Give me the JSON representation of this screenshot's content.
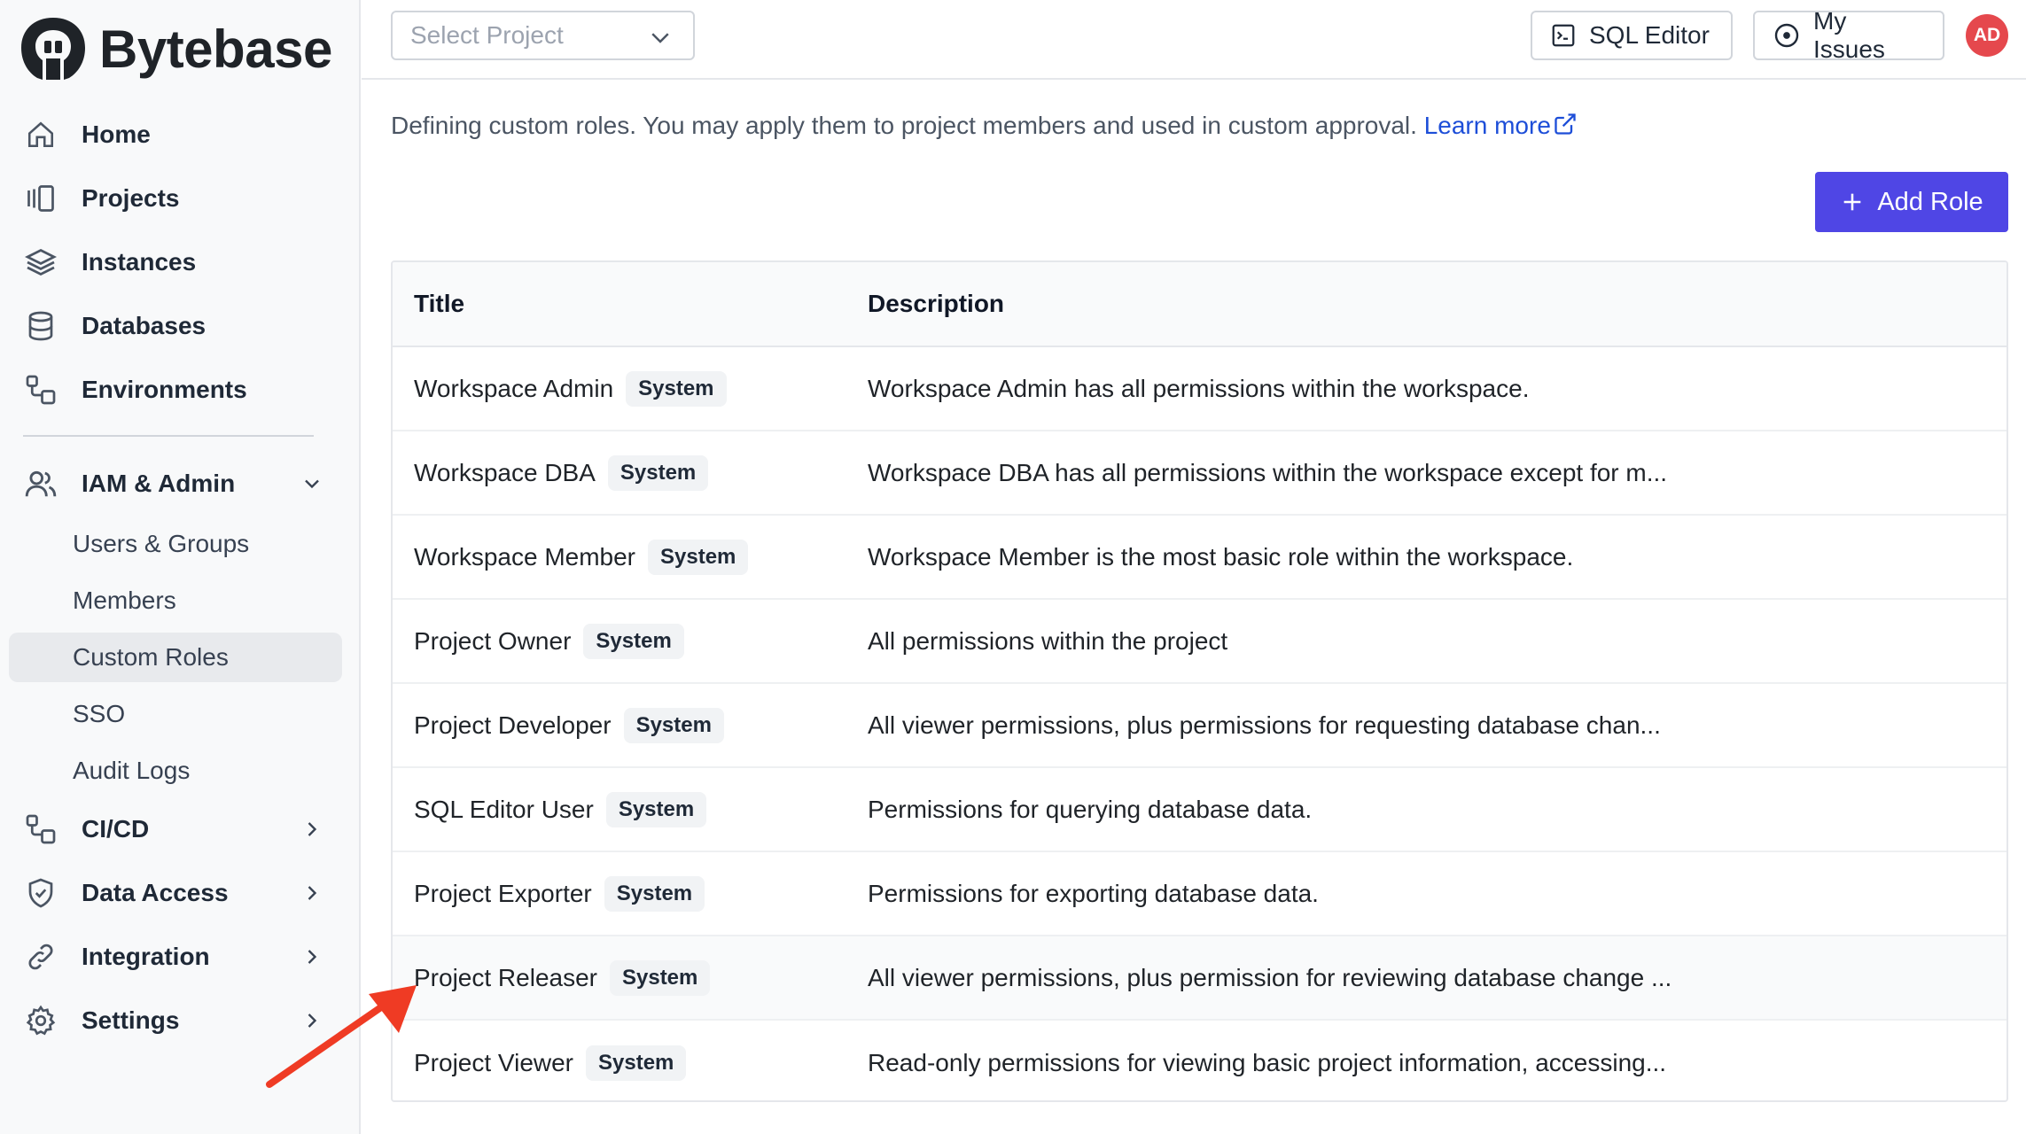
{
  "brand": {
    "name": "Bytebase"
  },
  "sidebar": {
    "items": [
      {
        "label": "Home",
        "icon": "home-icon"
      },
      {
        "label": "Projects",
        "icon": "projects-icon"
      },
      {
        "label": "Instances",
        "icon": "layers-icon"
      },
      {
        "label": "Databases",
        "icon": "database-icon"
      },
      {
        "label": "Environments",
        "icon": "environments-icon"
      }
    ],
    "iam": {
      "label": "IAM & Admin",
      "icon": "users-icon",
      "expanded": true,
      "children": [
        "Users & Groups",
        "Members",
        "Custom Roles",
        "SSO",
        "Audit Logs"
      ],
      "active": "Custom Roles"
    },
    "bottom_items": [
      {
        "label": "CI/CD",
        "icon": "cicd-icon"
      },
      {
        "label": "Data Access",
        "icon": "shield-icon"
      },
      {
        "label": "Integration",
        "icon": "link-icon"
      },
      {
        "label": "Settings",
        "icon": "gear-icon"
      }
    ]
  },
  "topbar": {
    "project_placeholder": "Select Project",
    "sql_editor": "SQL Editor",
    "my_issues": "My Issues",
    "avatar_initials": "AD",
    "avatar_color": "#e5484d"
  },
  "page": {
    "description": "Defining custom roles. You may apply them to project members and used in custom approval.",
    "learn_more": "Learn more",
    "add_role": "Add Role",
    "accent": "#4f46e5"
  },
  "table": {
    "headers": {
      "title": "Title",
      "description": "Description"
    },
    "rows": [
      {
        "title": "Workspace Admin",
        "badge": "System",
        "description": "Workspace Admin has all permissions within the workspace."
      },
      {
        "title": "Workspace DBA",
        "badge": "System",
        "description": "Workspace DBA has all permissions within the workspace except for m..."
      },
      {
        "title": "Workspace Member",
        "badge": "System",
        "description": "Workspace Member is the most basic role within the workspace."
      },
      {
        "title": "Project Owner",
        "badge": "System",
        "description": "All permissions within the project"
      },
      {
        "title": "Project Developer",
        "badge": "System",
        "description": "All viewer permissions, plus permissions for requesting database chan..."
      },
      {
        "title": "SQL Editor User",
        "badge": "System",
        "description": "Permissions for querying database data."
      },
      {
        "title": "Project Exporter",
        "badge": "System",
        "description": "Permissions for exporting database data."
      },
      {
        "title": "Project Releaser",
        "badge": "System",
        "description": "All viewer permissions, plus permission for reviewing database change ..."
      },
      {
        "title": "Project Viewer",
        "badge": "System",
        "description": "Read-only permissions for viewing basic project information, accessing..."
      }
    ]
  },
  "annotation": {
    "color": "#ef3b24"
  }
}
